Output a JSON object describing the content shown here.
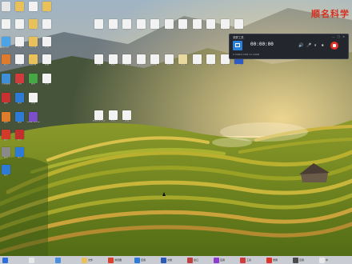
{
  "watermark": "顺名科学",
  "left_icons": [
    {
      "label": "回收站",
      "color": "#e6e6e6"
    },
    {
      "label": "文件夹",
      "color": "#e9c15a"
    },
    {
      "label": "文档",
      "color": "#f2f2f2"
    },
    {
      "label": "文件夹",
      "color": "#e9c15a"
    },
    {
      "label": "文档",
      "color": "#f2f2f2"
    },
    {
      "label": "文档",
      "color": "#f2f2f2"
    },
    {
      "label": "文件夹",
      "color": "#e9c15a"
    },
    {
      "label": "文档",
      "color": "#f2f2f2"
    },
    {
      "label": "此电脑",
      "color": "#4da3e8"
    },
    {
      "label": "文档",
      "color": "#f2f2f2"
    },
    {
      "label": "文件夹",
      "color": "#e9c15a"
    },
    {
      "label": "文档",
      "color": "#f2f2f2"
    },
    {
      "label": "软件",
      "color": "#e07b2b"
    },
    {
      "label": "文档",
      "color": "#f2f2f2"
    },
    {
      "label": "文件夹",
      "color": "#e9c15a"
    },
    {
      "label": "文档",
      "color": "#f2f2f2"
    },
    {
      "label": "控制面板",
      "color": "#3f8fd8"
    },
    {
      "label": "应用",
      "color": "#d23b3b"
    },
    {
      "label": "应用",
      "color": "#45a845"
    },
    {
      "label": "文档",
      "color": "#f2f2f2"
    },
    {
      "label": "应用",
      "color": "#c83131"
    },
    {
      "label": "应用",
      "color": "#2d7bd6"
    },
    {
      "label": "文档",
      "color": "#f2f2f2"
    },
    {
      "label": "应用",
      "color": "#e07b2b"
    },
    {
      "label": "应用",
      "color": "#2d7bd6"
    },
    {
      "label": "Visual Studio",
      "color": "#7a4fc9"
    },
    {
      "label": "应用",
      "color": "#d43a2a"
    },
    {
      "label": "应用",
      "color": "#c22f2f"
    },
    {
      "label": "应用",
      "color": "#8a8a8a"
    },
    {
      "label": "应用",
      "color": "#2d7bd6"
    },
    {
      "label": "应用",
      "color": "#2d7bd6"
    }
  ],
  "center_icons_row1": [
    {
      "label": "文档",
      "color": "#f2f2f2"
    },
    {
      "label": "文档",
      "color": "#f2f2f2"
    },
    {
      "label": "文档",
      "color": "#f2f2f2"
    },
    {
      "label": "文档",
      "color": "#f2f2f2"
    },
    {
      "label": "文档",
      "color": "#f2f2f2"
    },
    {
      "label": "文档",
      "color": "#f2f2f2"
    },
    {
      "label": "文档",
      "color": "#f2f2f2"
    },
    {
      "label": "文档",
      "color": "#f2f2f2"
    },
    {
      "label": "文档",
      "color": "#f2f2f2"
    },
    {
      "label": "文档",
      "color": "#f2f2f2"
    },
    {
      "label": "文档",
      "color": "#f2f2f2"
    }
  ],
  "center_icons_row2": [
    {
      "label": "文档",
      "color": "#f2f2f2"
    },
    {
      "label": "文档",
      "color": "#f2f2f2"
    },
    {
      "label": "文档",
      "color": "#f2f2f2"
    },
    {
      "label": "文档",
      "color": "#f2f2f2"
    },
    {
      "label": "文档",
      "color": "#f2f2f2"
    },
    {
      "label": "文档",
      "color": "#f2f2f2"
    },
    {
      "label": "文档",
      "color": "#e8d9a0"
    },
    {
      "label": "文档",
      "color": "#f2f2f2"
    },
    {
      "label": "文档",
      "color": "#f2f2f2"
    },
    {
      "label": "文档",
      "color": "#f2f2f2"
    },
    {
      "label": "应用",
      "color": "#2d5bc4"
    }
  ],
  "center_icons_row3": [
    {
      "label": "新建文本文档",
      "color": "#f2f2f2"
    },
    {
      "label": "文档",
      "color": "#f2f2f2"
    },
    {
      "label": "文档",
      "color": "#f2f2f2"
    }
  ],
  "recorder": {
    "title": "录屏工具",
    "window_buttons": "— □ ✕",
    "timer": "00:00:00",
    "size_text": "0.0GB/0.0GB   31.44GB",
    "controls": [
      "🔊",
      "🎤",
      "⏸",
      "⏹"
    ]
  },
  "taskbar": {
    "items": [
      {
        "label": "",
        "color": "#2a6fdb"
      },
      {
        "label": "",
        "color": "#e8e8e8"
      },
      {
        "label": "",
        "color": "#4b8fe0"
      },
      {
        "label": "文件",
        "color": "#e9c15a"
      },
      {
        "label": "浏览器",
        "color": "#d9412b"
      },
      {
        "label": "应用",
        "color": "#2d7bd6"
      },
      {
        "label": "文档",
        "color": "#2a5bb8"
      },
      {
        "label": "窗口",
        "color": "#c23f3f"
      },
      {
        "label": "应用",
        "color": "#8e3bd0"
      },
      {
        "label": "工具",
        "color": "#d23b3b"
      },
      {
        "label": "录屏",
        "color": "#e0342b"
      },
      {
        "label": "应用",
        "color": "#4b4b4b"
      },
      {
        "label": "中",
        "color": "#e8e8e8"
      }
    ]
  }
}
